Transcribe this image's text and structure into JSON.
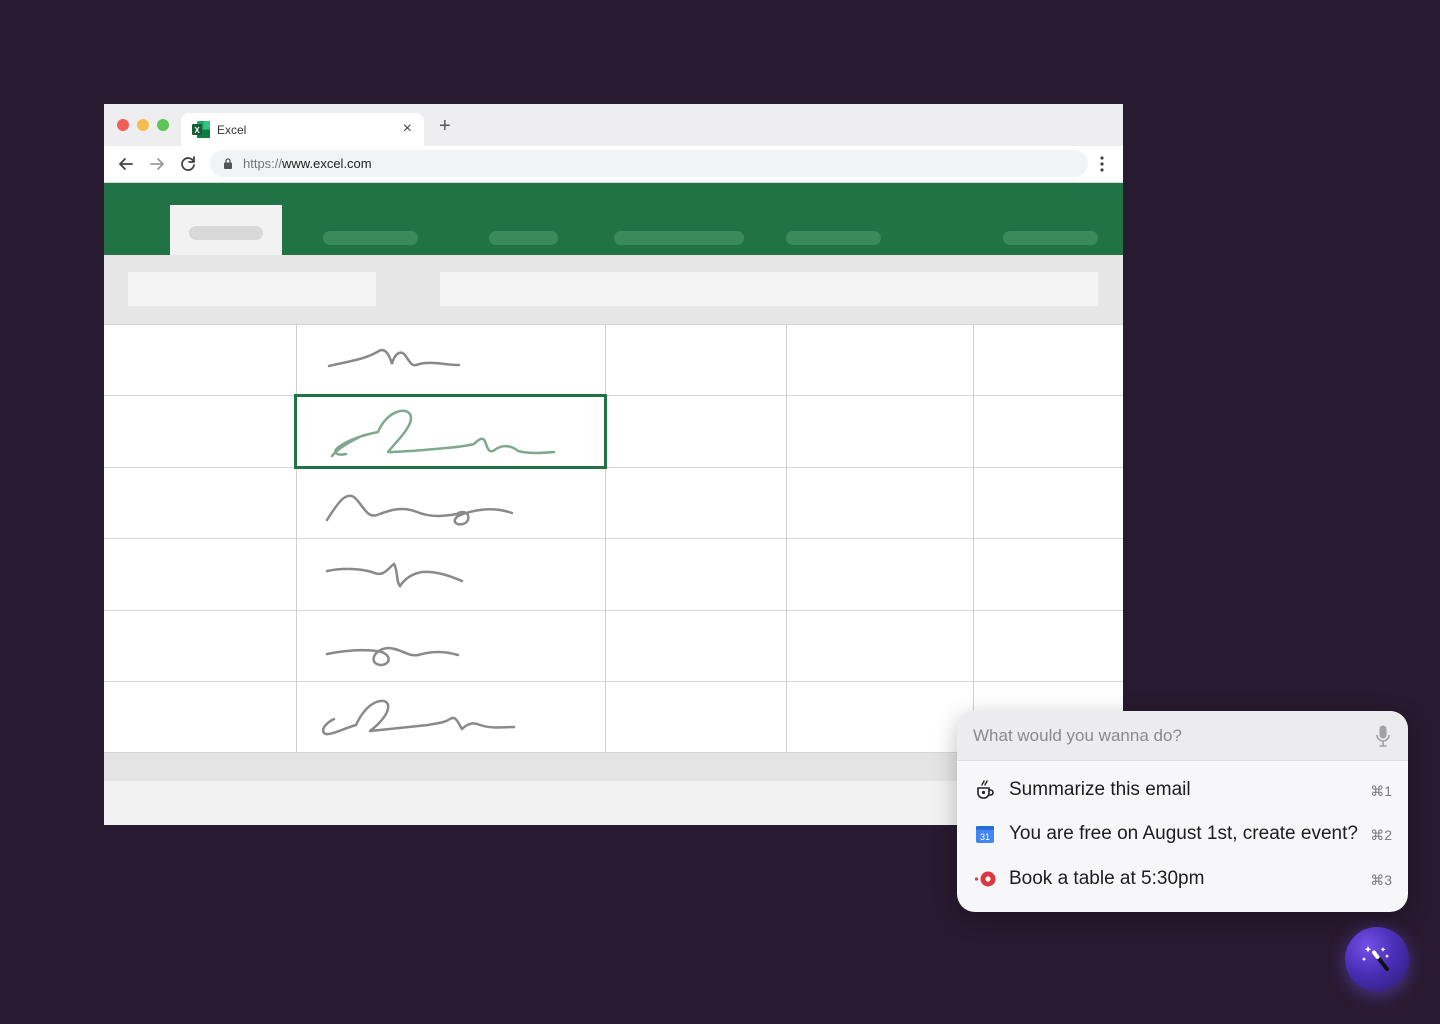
{
  "browser": {
    "tab": {
      "title": "Excel",
      "icon": "excel-icon"
    },
    "new_tab_label": "+",
    "close_label": "×",
    "url": {
      "scheme": "https://",
      "host": "www.excel.com"
    }
  },
  "colors": {
    "background": "#281a30",
    "excel_green": "#217346",
    "selection_scribble": "#7fa88f",
    "scribble": "#8a8a8a"
  },
  "assistant": {
    "placeholder": "What would you wanna do?",
    "suggestions": [
      {
        "icon": "coffee-cup-icon",
        "label": "Summarize this email",
        "shortcut": "⌘1"
      },
      {
        "icon": "calendar-icon",
        "label": "You are free on August 1st, create event?",
        "shortcut": "⌘2",
        "icon_text": "31"
      },
      {
        "icon": "opentable-icon",
        "label": "Book a table at 5:30pm",
        "shortcut": "⌘3"
      }
    ],
    "fab_icon": "magic-wand-icon"
  }
}
